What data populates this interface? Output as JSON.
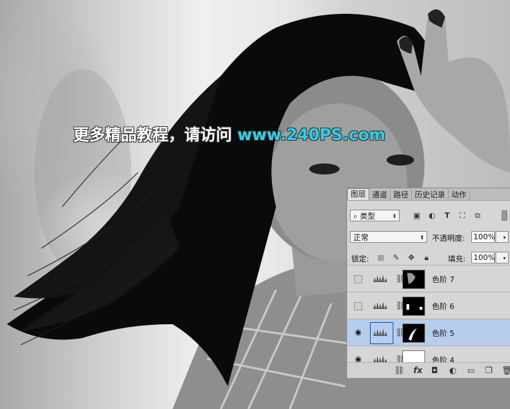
{
  "watermark": {
    "text_cn": "更多精品教程，请访问",
    "url": "www.240PS.com"
  },
  "panel": {
    "tabs": [
      "图层",
      "通道",
      "路径",
      "历史记录",
      "动作"
    ],
    "filter": {
      "label": "类型"
    },
    "blend": {
      "mode": "正常",
      "opacity_label": "不透明度:",
      "opacity": "100%"
    },
    "lock": {
      "label": "锁定:",
      "fill_label": "填充:",
      "fill": "100%"
    },
    "layers": [
      {
        "name": "色阶 7",
        "visible": false,
        "selected": false
      },
      {
        "name": "色阶 6",
        "visible": false,
        "selected": false
      },
      {
        "name": "色阶 5",
        "visible": true,
        "selected": true
      },
      {
        "name": "色阶 4",
        "visible": true,
        "selected": false
      }
    ],
    "bottom_fx": "fx"
  }
}
